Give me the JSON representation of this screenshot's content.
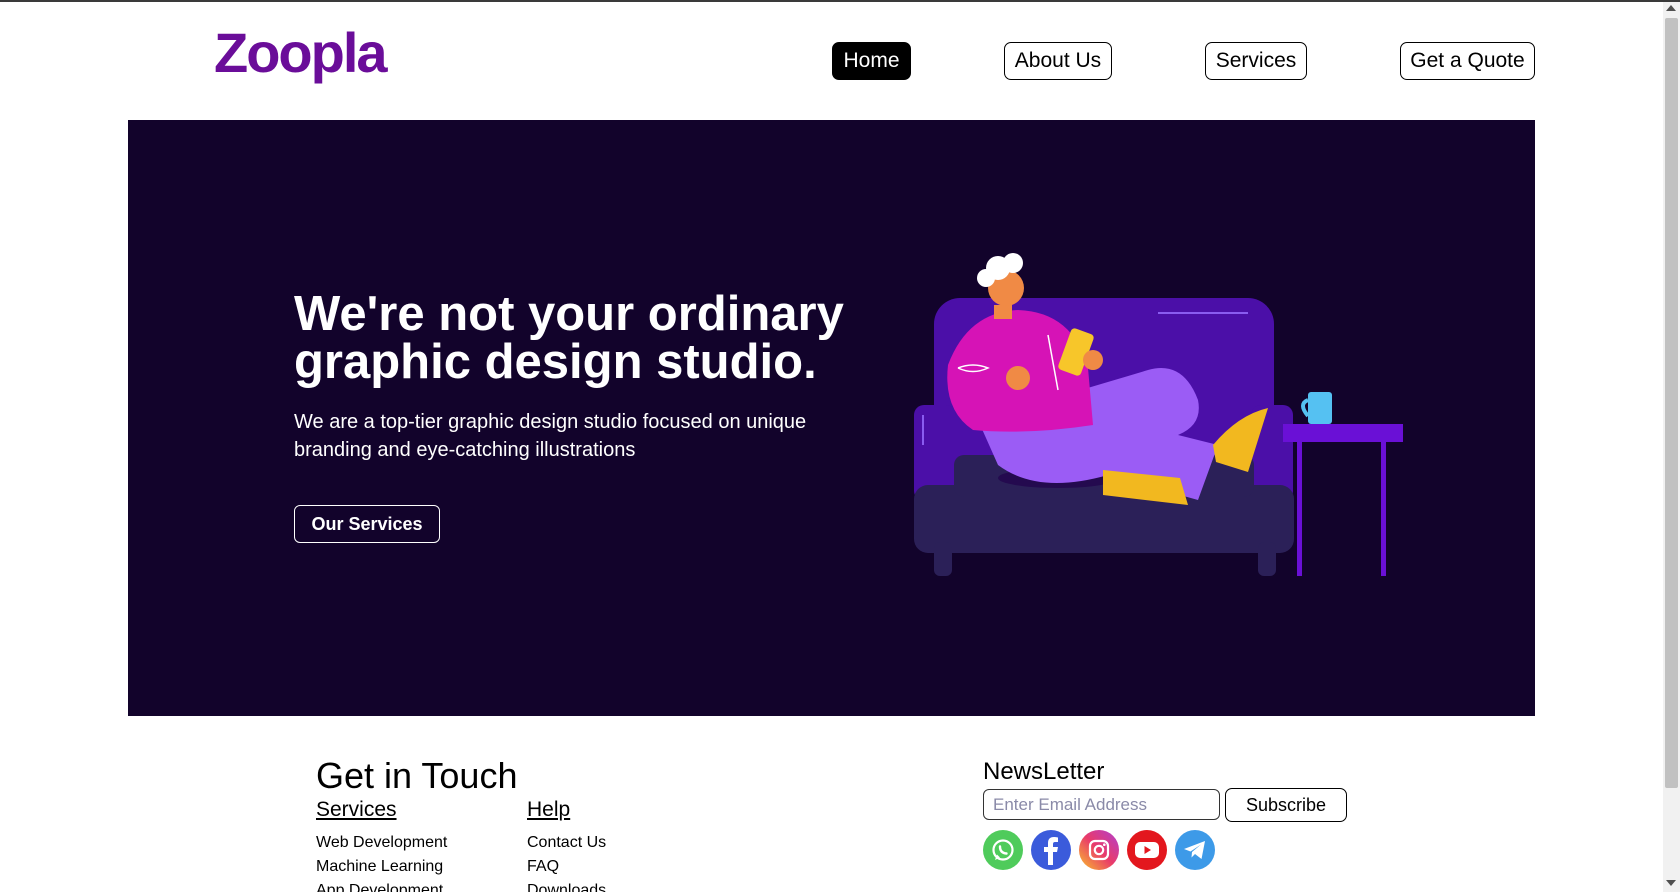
{
  "header": {
    "logo_text": "Zoopla",
    "logo_color": "#6a0d99",
    "nav": [
      {
        "label": "Home",
        "active": true
      },
      {
        "label": "About Us",
        "active": false
      },
      {
        "label": "Services",
        "active": false
      },
      {
        "label": "Get a Quote",
        "active": false
      }
    ]
  },
  "hero": {
    "title_line1": "We're not your ordinary",
    "title_line2": "graphic design studio.",
    "subtitle_line1": "We are a top-tier graphic design studio focused on unique",
    "subtitle_line2": "branding and eye-catching illustrations",
    "cta_label": "Our Services",
    "background": "#12032b"
  },
  "footer": {
    "title": "Get in Touch",
    "services": {
      "heading": "Services",
      "items": [
        "Web Development",
        "Machine Learning",
        "App Development"
      ]
    },
    "help": {
      "heading": "Help",
      "items": [
        "Contact Us",
        "FAQ",
        "Downloads"
      ]
    },
    "newsletter": {
      "title": "NewsLetter",
      "email_placeholder": "Enter Email Address",
      "subscribe_label": "Subscribe"
    },
    "social": [
      {
        "name": "whatsapp-icon",
        "color": "#4fcb5b"
      },
      {
        "name": "facebook-icon",
        "color": "#3b5bdb"
      },
      {
        "name": "instagram-icon",
        "color": "#d6249f"
      },
      {
        "name": "youtube-icon",
        "color": "#e3171e"
      },
      {
        "name": "telegram-icon",
        "color": "#3d9ae8"
      }
    ]
  }
}
